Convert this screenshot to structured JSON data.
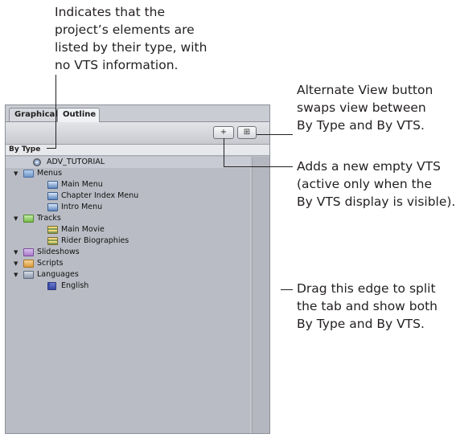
{
  "callouts": {
    "by_type": [
      "Indicates that the",
      "project’s elements are",
      "listed by their type, with",
      "no VTS information."
    ],
    "alternate_view": [
      "Alternate View button",
      "swaps view between",
      "By Type and By VTS."
    ],
    "add_vts": [
      "Adds a new empty VTS",
      "(active only when the",
      "By VTS display is visible)."
    ],
    "drag_edge": [
      "Drag this edge to split",
      "the tab and show both",
      "By Type and By VTS."
    ]
  },
  "tabs": {
    "graphical": "Graphical",
    "outline": "Outline"
  },
  "toolbar": {
    "add_vts_button": "+",
    "alternate_view_button": "⊞"
  },
  "view_header": "By Type",
  "tree": [
    {
      "label": "ADV_TUTORIAL",
      "icon": "disc-icon",
      "level": 1,
      "expander": false,
      "selected": true
    },
    {
      "label": "Menus",
      "icon": "folder-icon",
      "color": "blue",
      "level": 0,
      "expander": true
    },
    {
      "label": "Main Menu",
      "icon": "menu-icon",
      "level": 2,
      "expander": false
    },
    {
      "label": "Chapter Index Menu",
      "icon": "menu-icon",
      "level": 2,
      "expander": false
    },
    {
      "label": "Intro Menu",
      "icon": "menu-icon",
      "level": 2,
      "expander": false
    },
    {
      "label": "Tracks",
      "icon": "folder-icon",
      "color": "green",
      "level": 0,
      "expander": true
    },
    {
      "label": "Main Movie",
      "icon": "track-icon",
      "level": 2,
      "expander": false
    },
    {
      "label": "Rider Biographies",
      "icon": "track-icon",
      "level": 2,
      "expander": false
    },
    {
      "label": "Slideshows",
      "icon": "folder-icon",
      "color": "purple",
      "level": 0,
      "expander": true
    },
    {
      "label": "Scripts",
      "icon": "folder-icon",
      "color": "orange",
      "level": 0,
      "expander": true
    },
    {
      "label": "Languages",
      "icon": "folder-icon",
      "color": "gray",
      "level": 0,
      "expander": true
    },
    {
      "label": "English",
      "icon": "flag-icon",
      "level": 2,
      "expander": false
    }
  ]
}
